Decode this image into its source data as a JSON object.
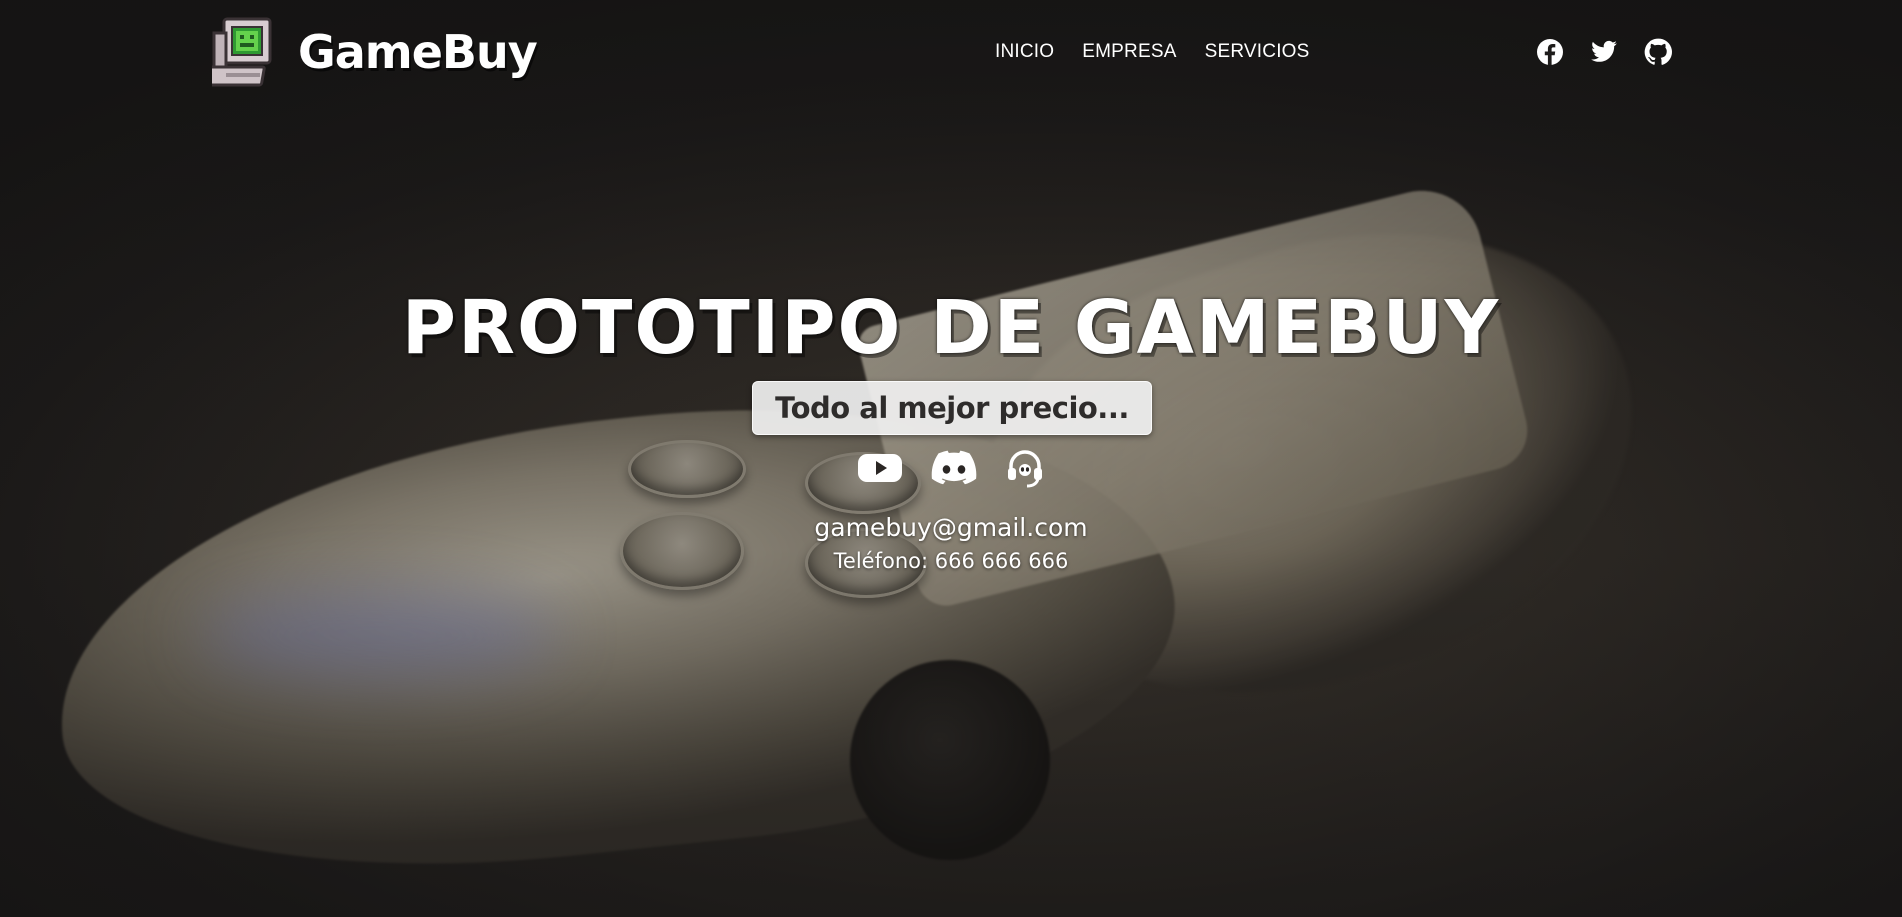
{
  "brand": {
    "name": "GameBuy",
    "logo_icon": "retro-computer-icon"
  },
  "nav": {
    "items": [
      {
        "label": "INICIO"
      },
      {
        "label": "EMPRESA"
      },
      {
        "label": "SERVICIOS"
      }
    ]
  },
  "social": {
    "icons": [
      "facebook-icon",
      "twitter-icon",
      "github-icon"
    ]
  },
  "hero": {
    "title": "PROTOTIPO DE GAMEBUY",
    "tagline": "Todo al mejor precio...",
    "icons": [
      "youtube-icon",
      "discord-icon",
      "headset-icon"
    ],
    "email": "gamebuy@gmail.com",
    "phone": "Teléfono: 666 666 666"
  },
  "colors": {
    "background": "#1e1c1b",
    "text": "#ffffff",
    "tagline_bg": "#f0f0f0",
    "tagline_text": "#2e2c2b",
    "logo_screen": "#3aa63a"
  }
}
